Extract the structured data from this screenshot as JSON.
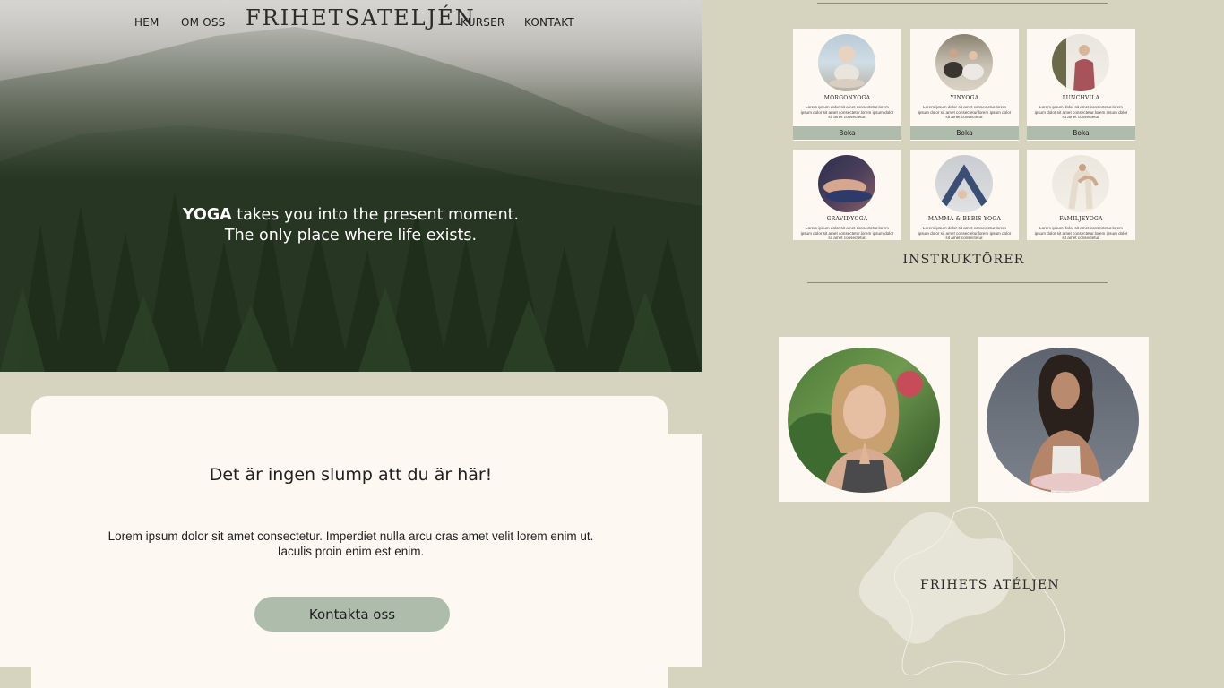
{
  "nav": {
    "logo": "FRIHETSATELJÉN",
    "links": [
      "HEM",
      "OM OSS",
      "KURSER",
      "KONTAKT"
    ]
  },
  "hero": {
    "bold": "YOGA",
    "line1_rest": " takes you into the present moment.",
    "line2": "The only place where life exists."
  },
  "intro": {
    "title": "Det är ingen slump att du är här!",
    "body_line1": "Lorem ipsum dolor sit amet consectetur. Imperdiet nulla arcu cras amet velit lorem enim ut.",
    "body_line2": "Iaculis proin enim est enim.",
    "cta": "Kontakta oss"
  },
  "courses": {
    "items": [
      {
        "name": "MORGONYOGA",
        "desc": "Lorem ipsum dolor sit amet consectetur.lorem ipsum dolor sit amet consectetur.lorem ipsum dolor sit amet consectetur.",
        "button": "Boka"
      },
      {
        "name": "YINYOGA",
        "desc": "Lorem ipsum dolor sit amet consectetur.lorem ipsum dolor sit amet consectetur.lorem ipsum dolor sit amet consectetur.",
        "button": "Boka"
      },
      {
        "name": "LUNCHVILA",
        "desc": "Lorem ipsum dolor sit amet consectetur.lorem ipsum dolor sit amet consectetur.lorem ipsum dolor sit amet consectetur.",
        "button": "Boka"
      },
      {
        "name": "GRAVIDYOGA",
        "desc": "Lorem ipsum dolor sit amet consectetur.lorem ipsum dolor sit amet consectetur.lorem ipsum dolor sit amet consectetur."
      },
      {
        "name": "MAMMA & BEBIS YOGA",
        "desc": "Lorem ipsum dolor sit amet consectetur.lorem ipsum dolor sit amet consectetur.lorem ipsum dolor sit amet consectetur."
      },
      {
        "name": "FAMILJEYOGA",
        "desc": "Lorem ipsum dolor sit amet consectetur.lorem ipsum dolor sit amet consectetur.lorem ipsum dolor sit amet consectetur."
      }
    ]
  },
  "instructors": {
    "title": "INSTRUKTÖRER",
    "footer_brand": "FRIHETS ATÉLJEN"
  },
  "colors": {
    "background": "#d6d3bf",
    "cream": "#fdf8f1",
    "sage": "#aebcac"
  }
}
